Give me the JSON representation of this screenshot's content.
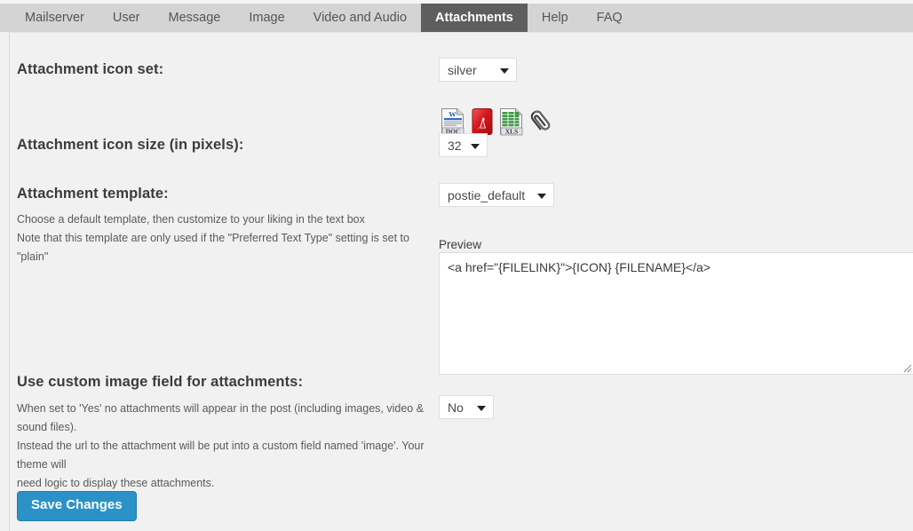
{
  "tabs": [
    {
      "label": "Mailserver",
      "active": false
    },
    {
      "label": "User",
      "active": false
    },
    {
      "label": "Message",
      "active": false
    },
    {
      "label": "Image",
      "active": false
    },
    {
      "label": "Video and Audio",
      "active": false
    },
    {
      "label": "Attachments",
      "active": true
    },
    {
      "label": "Help",
      "active": false
    },
    {
      "label": "FAQ",
      "active": false
    }
  ],
  "settings": {
    "icon_set": {
      "title": "Attachment icon set:",
      "value": "silver",
      "icons": [
        "doc-file-icon",
        "pdf-file-icon",
        "xls-file-icon",
        "paperclip-icon"
      ]
    },
    "icon_size": {
      "title": "Attachment icon size (in pixels):",
      "value": "32"
    },
    "template": {
      "title": "Attachment template:",
      "desc_line1": "Choose a default template, then customize to your liking in the text box",
      "desc_line2": "Note that this template are only used if the \"Preferred Text Type\" setting is set to \"plain\"",
      "value": "postie_default",
      "preview_label": "Preview",
      "preview_value": "<a href=\"{FILELINK}\">{ICON} {FILENAME}</a>"
    },
    "custom_image_field": {
      "title": "Use custom image field for attachments:",
      "desc_line1": "When set to 'Yes' no attachments will appear in the post (including images, video & sound files).",
      "desc_line2": "Instead the url to the attachment will be put into a custom field named 'image'. Your theme will",
      "desc_line3": "need logic to display these attachments.",
      "value": "No"
    }
  },
  "save_button": {
    "label": "Save Changes"
  },
  "colors": {
    "page_background": "#f1f1f1",
    "tabbar_background": "#d4d4d4",
    "active_tab_background": "#5e5e5e",
    "save_button": "#2b92c8",
    "pdf_icon_red": "#d01f1f",
    "xls_icon_green": "#3a9a42",
    "doc_icon_blue": "#2a5fa8"
  }
}
